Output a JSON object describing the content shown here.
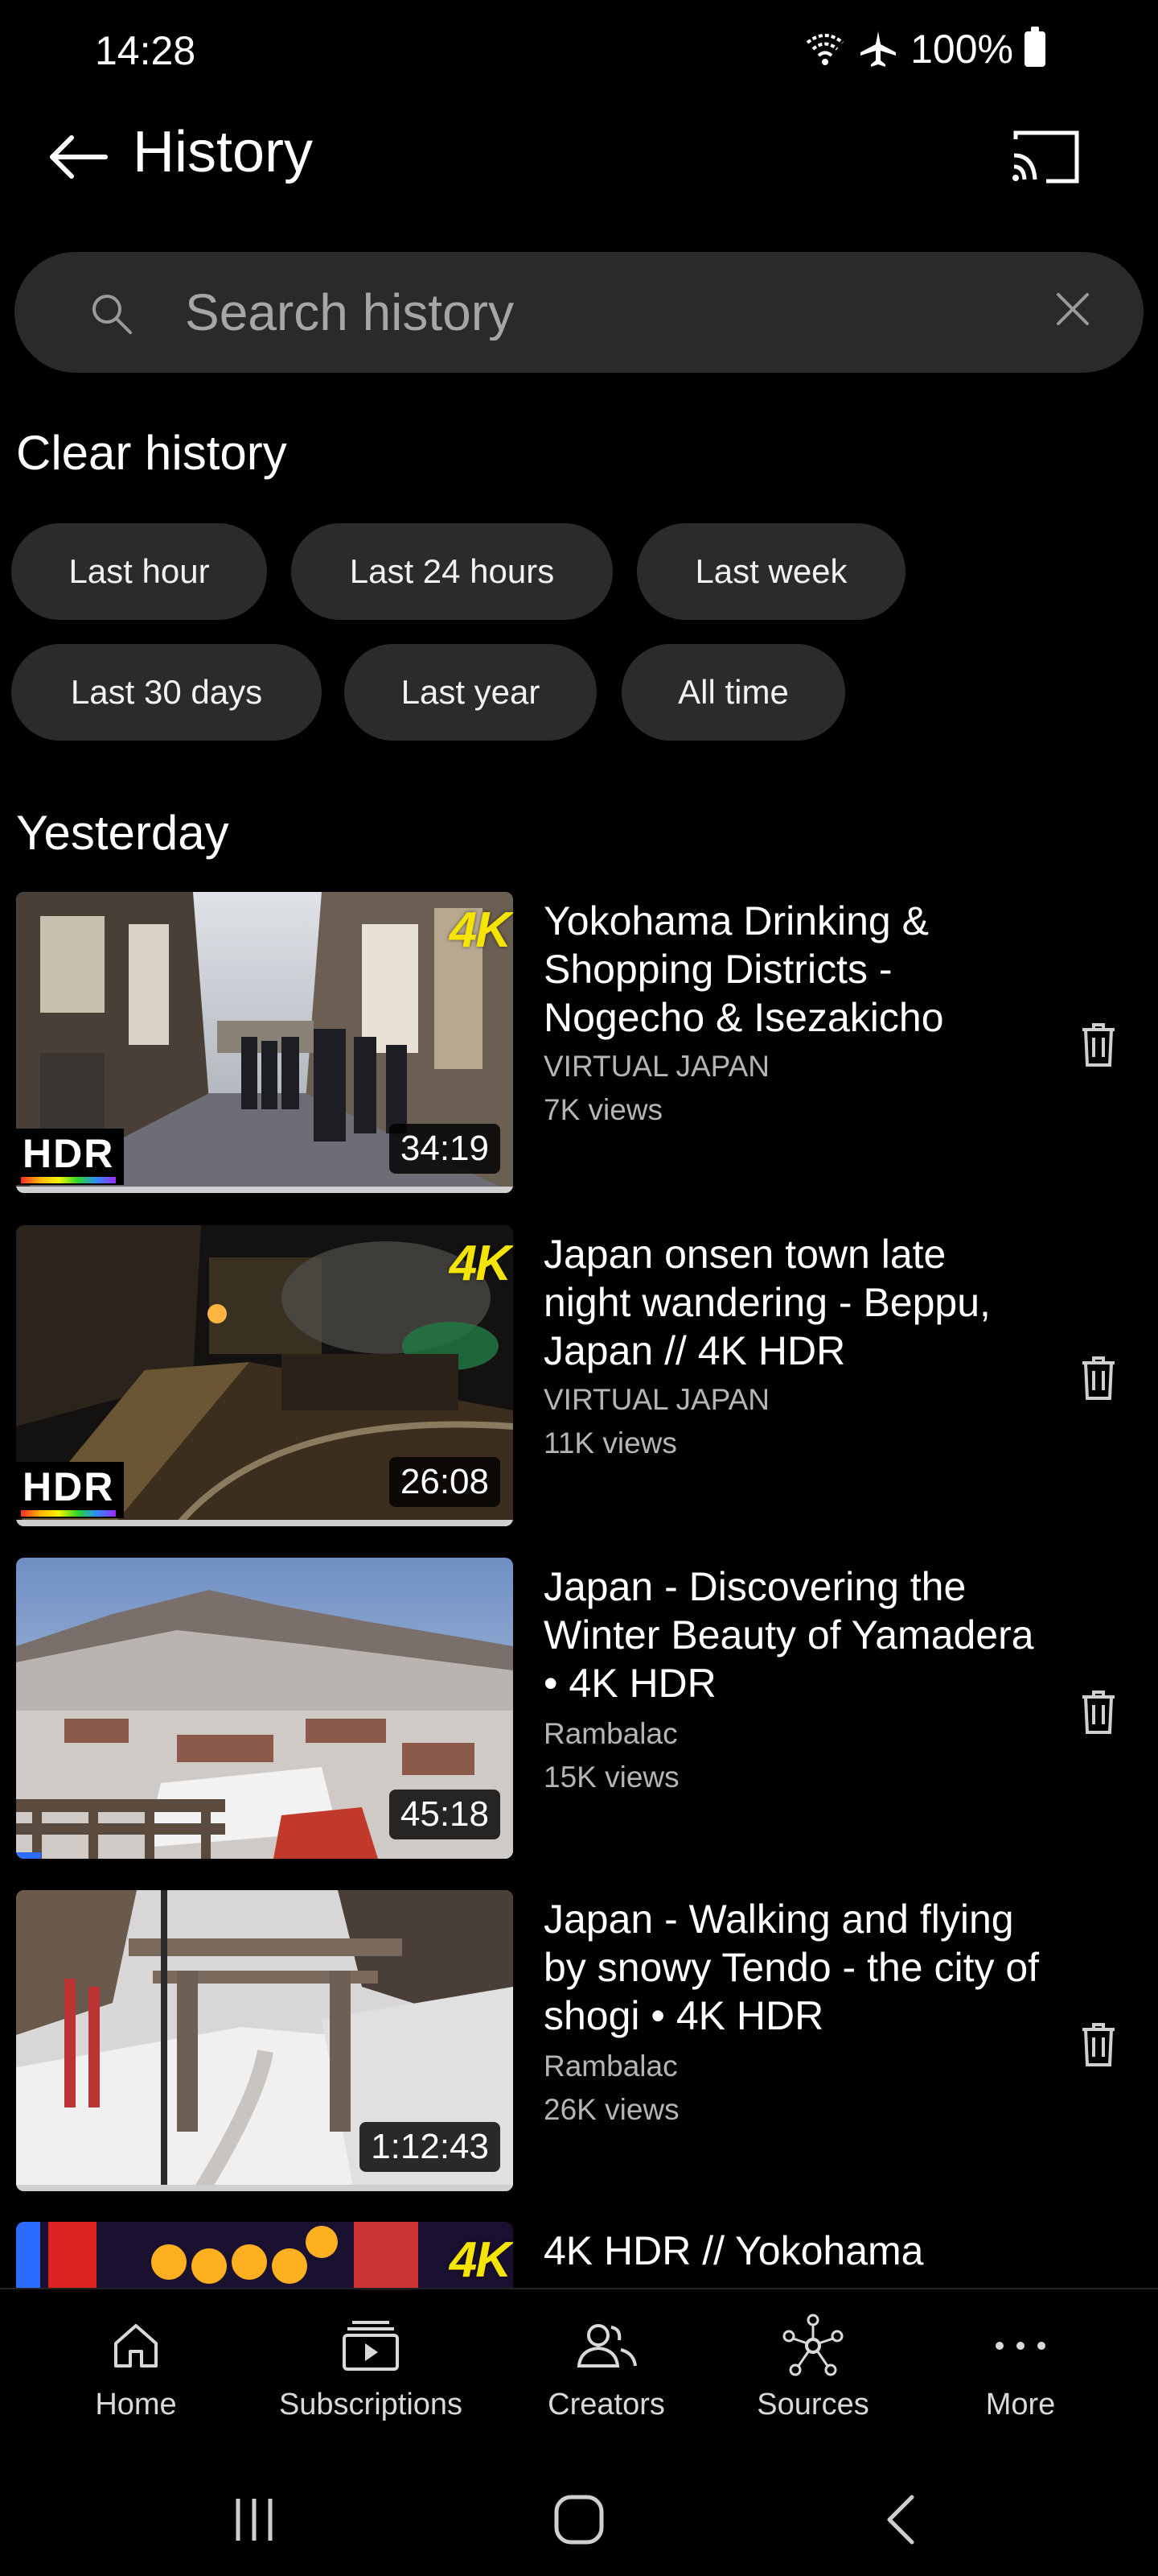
{
  "status_bar": {
    "time": "14:28",
    "battery": "100%",
    "icons": [
      "wifi-icon",
      "airplane-icon",
      "battery-icon"
    ]
  },
  "header": {
    "title": "History",
    "back_icon": "arrow-left-icon",
    "cast_icon": "cast-icon"
  },
  "search": {
    "placeholder": "Search history",
    "value": "",
    "icon": "search-icon",
    "clear_icon": "close-icon"
  },
  "clear_history": {
    "title": "Clear history",
    "chips": [
      "Last hour",
      "Last 24 hours",
      "Last week",
      "Last 30 days",
      "Last year",
      "All time"
    ]
  },
  "section": {
    "title": "Yesterday"
  },
  "videos": [
    {
      "title": "Yokohama Drinking & Shopping Districts - Nogecho & Isezakicho",
      "channel": "VIRTUAL JAPAN",
      "views": "7K views",
      "duration": "34:19",
      "badge_4k": "4K",
      "badge_hdr": "HDR",
      "progress": 1.0
    },
    {
      "title": "Japan onsen town late night wandering - Beppu, Japan // 4K HDR",
      "channel": "VIRTUAL JAPAN",
      "views": "11K views",
      "duration": "26:08",
      "badge_4k": "4K",
      "badge_hdr": "HDR",
      "progress": 1.0
    },
    {
      "title": "Japan - Discovering the Winter Beauty of Yamadera • 4K HDR",
      "channel": "Rambalac",
      "views": "15K views",
      "duration": "45:18",
      "badge_4k": "",
      "badge_hdr": "",
      "progress": 0.05
    },
    {
      "title": "Japan - Walking and flying by snowy Tendo - the city of shogi • 4K HDR",
      "channel": "Rambalac",
      "views": "26K views",
      "duration": "1:12:43",
      "badge_4k": "",
      "badge_hdr": "",
      "progress": 1.0
    },
    {
      "title": "4K HDR // Yokohama",
      "channel": "",
      "views": "",
      "duration": "",
      "badge_4k": "4K",
      "badge_hdr": "",
      "progress": 0
    }
  ],
  "bottom_nav": {
    "items": [
      {
        "label": "Home",
        "icon": "home-icon"
      },
      {
        "label": "Subscriptions",
        "icon": "subscriptions-icon"
      },
      {
        "label": "Creators",
        "icon": "creators-icon"
      },
      {
        "label": "Sources",
        "icon": "sources-icon"
      },
      {
        "label": "More",
        "icon": "more-icon"
      }
    ]
  },
  "colors": {
    "background": "#000000",
    "chip": "#2b2b2b",
    "search_bg": "#2a2a2a",
    "secondary_text": "#b5b5b5",
    "accent_4k": "#f5e400"
  }
}
